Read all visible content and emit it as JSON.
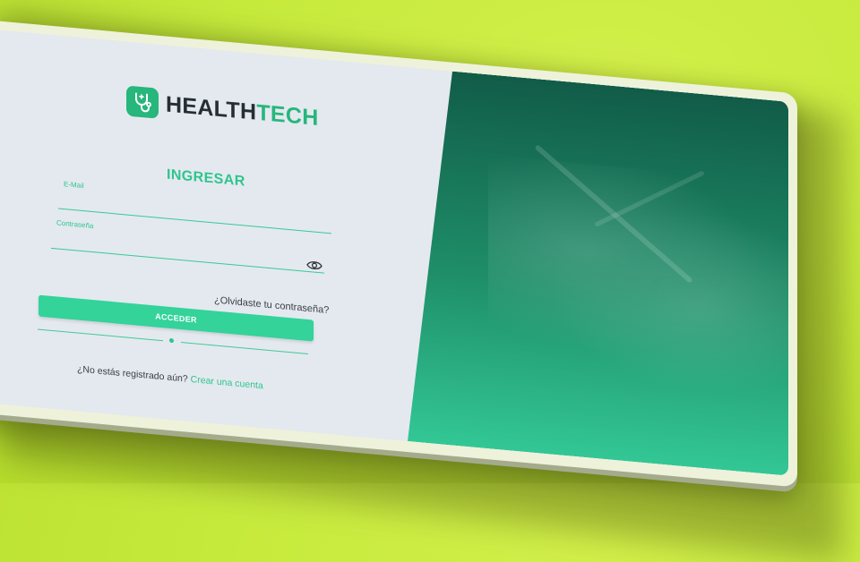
{
  "brand": {
    "name_part1": "HEALTH",
    "name_part2": "TECH",
    "accent": "#2ec58d"
  },
  "login": {
    "title": "INGRESAR",
    "email": {
      "label": "E-Mail",
      "value": "",
      "placeholder": ""
    },
    "password": {
      "label": "Contraseña",
      "value": "",
      "placeholder": "",
      "toggle_icon": "eye-icon"
    },
    "forgot_link": "¿Olvidaste tu contraseña?",
    "submit_label": "ACCEDER",
    "signup_prompt": "¿No estás registrado aún?",
    "signup_link": "Crear una cuenta"
  },
  "colors": {
    "background": "#c6ea3c",
    "form_panel": "#e4e9ef",
    "panel_gradient_top": "#115c48",
    "panel_gradient_bottom": "#33c795",
    "button": "#33d39a"
  }
}
